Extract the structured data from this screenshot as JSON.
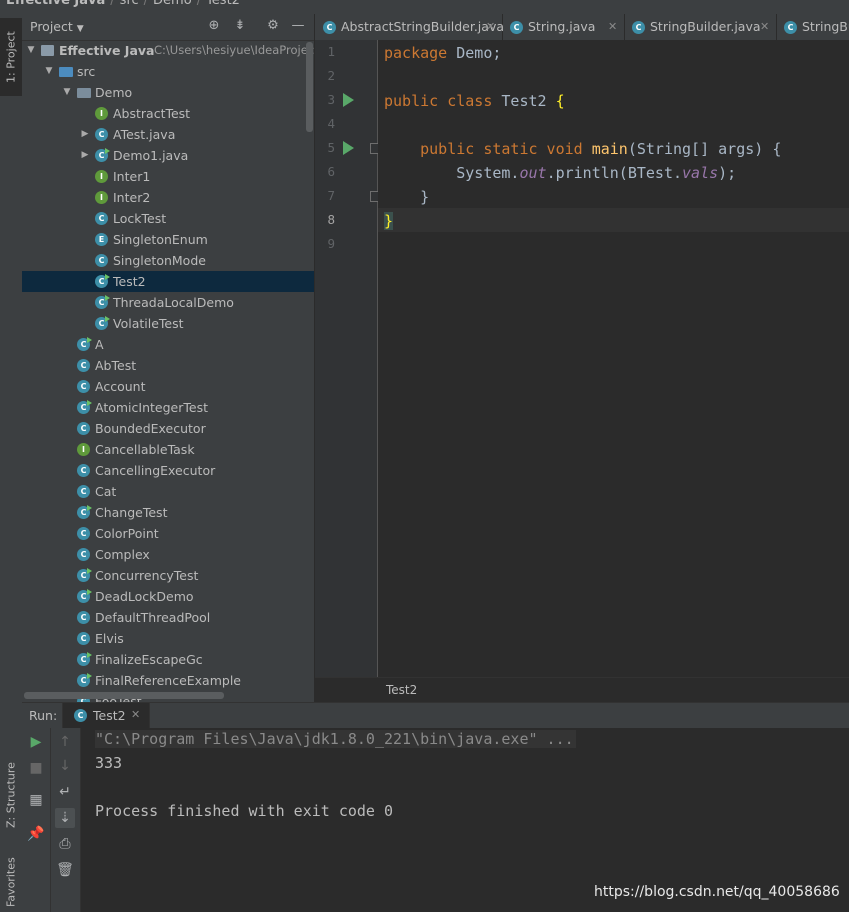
{
  "breadcrumb": {
    "project": "Effective Java",
    "items": [
      "src",
      "Demo",
      "Test2"
    ]
  },
  "side_tabs": {
    "project": "1: Project",
    "structure": "Z: Structure",
    "favorites": "Favorites"
  },
  "project_panel": {
    "title": "Project",
    "tree": [
      {
        "label": "Effective Java",
        "path": "C:\\Users\\hesiyue\\IdeaProjec",
        "icon": "module-icon",
        "depth": 0,
        "arrow": "expanded",
        "bold": true
      },
      {
        "label": "src",
        "icon": "source-folder-icon",
        "depth": 1,
        "arrow": "expanded"
      },
      {
        "label": "Demo",
        "icon": "package-folder-icon",
        "depth": 2,
        "arrow": "expanded"
      },
      {
        "label": "AbstractTest",
        "icon": "interface-icon",
        "depth": 3
      },
      {
        "label": "ATest.java",
        "icon": "class-icon",
        "depth": 3,
        "arrow": "collapsed"
      },
      {
        "label": "Demo1.java",
        "icon": "runnable-class-icon",
        "depth": 3,
        "arrow": "collapsed"
      },
      {
        "label": "Inter1",
        "icon": "interface-icon",
        "depth": 3
      },
      {
        "label": "Inter2",
        "icon": "interface-icon",
        "depth": 3
      },
      {
        "label": "LockTest",
        "icon": "class-icon",
        "depth": 3
      },
      {
        "label": "SingletonEnum",
        "icon": "enum-icon",
        "depth": 3
      },
      {
        "label": "SingletonMode",
        "icon": "class-icon",
        "depth": 3
      },
      {
        "label": "Test2",
        "icon": "runnable-class-icon",
        "depth": 3,
        "selected": true
      },
      {
        "label": "ThreadaLocalDemo",
        "icon": "runnable-class-icon",
        "depth": 3
      },
      {
        "label": "VolatileTest",
        "icon": "runnable-class-icon",
        "depth": 3
      },
      {
        "label": "A",
        "icon": "runnable-class-icon",
        "depth": 2
      },
      {
        "label": "AbTest",
        "icon": "abstract-class-icon",
        "depth": 2
      },
      {
        "label": "Account",
        "icon": "class-icon",
        "depth": 2
      },
      {
        "label": "AtomicIntegerTest",
        "icon": "runnable-class-icon",
        "depth": 2
      },
      {
        "label": "BoundedExecutor",
        "icon": "class-icon",
        "depth": 2
      },
      {
        "label": "CancellableTask",
        "icon": "interface-icon",
        "depth": 2
      },
      {
        "label": "CancellingExecutor",
        "icon": "class-icon",
        "depth": 2
      },
      {
        "label": "Cat",
        "icon": "class-icon",
        "depth": 2
      },
      {
        "label": "ChangeTest",
        "icon": "runnable-class-icon",
        "depth": 2
      },
      {
        "label": "ColorPoint",
        "icon": "class-icon",
        "depth": 2
      },
      {
        "label": "Complex",
        "icon": "class-icon",
        "depth": 2
      },
      {
        "label": "ConcurrencyTest",
        "icon": "runnable-class-icon",
        "depth": 2
      },
      {
        "label": "DeadLockDemo",
        "icon": "runnable-class-icon",
        "depth": 2
      },
      {
        "label": "DefaultThreadPool",
        "icon": "class-icon",
        "depth": 2
      },
      {
        "label": "Elvis",
        "icon": "class-icon",
        "depth": 2
      },
      {
        "label": "FinalizeEscapeGc",
        "icon": "runnable-class-icon",
        "depth": 2
      },
      {
        "label": "FinalReferenceExample",
        "icon": "runnable-class-icon",
        "depth": 2
      },
      {
        "label": "FooTest",
        "icon": "class-icon",
        "depth": 2
      }
    ]
  },
  "editor": {
    "tabs": [
      {
        "label": "AbstractStringBuilder.java",
        "closable": true
      },
      {
        "label": "String.java",
        "closable": true
      },
      {
        "label": "StringBuilder.java",
        "closable": true
      },
      {
        "label": "StringBuilder.java",
        "closable": false
      }
    ],
    "line_numbers": [
      "1",
      "2",
      "3",
      "4",
      "5",
      "6",
      "7",
      "8",
      "9"
    ],
    "code": {
      "line1_kw": "package",
      "line1_rest": " Demo;",
      "line3_kw": "public class",
      "line3_name": " Test2 ",
      "line3_brace": "{",
      "line5_kw": "    public static void",
      "line5_fn": " main",
      "line5_rest": "(String[] args) {",
      "line6_a": "        System.",
      "line6_out": "out",
      "line6_b": ".println(BTest.",
      "line6_vals": "vals",
      "line6_c": ");",
      "line7": "    }",
      "line8_brace": "}"
    },
    "breadcrumb": "Test2"
  },
  "run_panel": {
    "label": "Run:",
    "tab_label": "Test2",
    "console": {
      "command": "\"C:\\Program Files\\Java\\jdk1.8.0_221\\bin\\java.exe\" ...",
      "output": "333",
      "exit": "Process finished with exit code 0"
    }
  },
  "watermark": "https://blog.csdn.net/qq_40058686",
  "colors": {
    "keyword": "#cc7832",
    "function": "#ffc66d",
    "field": "#9876aa",
    "selection": "#0d293e",
    "run_green": "#59a869"
  }
}
